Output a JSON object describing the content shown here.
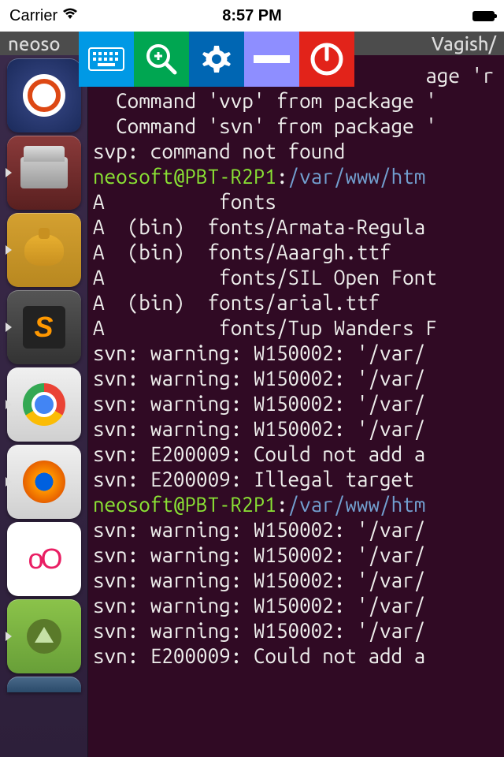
{
  "status_bar": {
    "carrier": "Carrier",
    "time": "8:57 PM"
  },
  "title_bar": {
    "left_text": "neoso",
    "right_text": "Vagish/"
  },
  "toolbar": {
    "keyboard_label": "keyboard",
    "zoom_label": "zoom",
    "settings_label": "settings",
    "minimize_label": "minimize",
    "power_label": "power"
  },
  "launcher_items": [
    "ubuntu-dash",
    "files",
    "genie-lamp",
    "sublime-text",
    "chrome",
    "firefox",
    "oo-app",
    "android-studio",
    "partial-app"
  ],
  "terminal": {
    "prompt_user": "neosoft@PBT-R2P1",
    "prompt_path": "/var/www/htm",
    "lines": [
      {
        "text": "                             age 'r"
      },
      {
        "text": "  Command 'vvp' from package '"
      },
      {
        "text": "  Command 'svn' from package '"
      },
      {
        "text": "svp: command not found"
      },
      {
        "prompt": true
      },
      {
        "text": "A          fonts"
      },
      {
        "text": "A  (bin)  fonts/Armata-Regula"
      },
      {
        "text": "A  (bin)  fonts/Aaargh.ttf"
      },
      {
        "text": "A          fonts/SIL Open Font"
      },
      {
        "text": "A  (bin)  fonts/arial.ttf"
      },
      {
        "text": "A          fonts/Tup Wanders F"
      },
      {
        "text": "svn: warning: W150002: '/var/"
      },
      {
        "text": "svn: warning: W150002: '/var/"
      },
      {
        "text": "svn: warning: W150002: '/var/"
      },
      {
        "text": "svn: warning: W150002: '/var/"
      },
      {
        "text": "svn: E200009: Could not add a"
      },
      {
        "text": "svn: E200009: Illegal target "
      },
      {
        "prompt": true
      },
      {
        "text": "svn: warning: W150002: '/var/"
      },
      {
        "text": "svn: warning: W150002: '/var/"
      },
      {
        "text": "svn: warning: W150002: '/var/"
      },
      {
        "text": "svn: warning: W150002: '/var/"
      },
      {
        "text": "svn: warning: W150002: '/var/"
      },
      {
        "text": "svn: E200009: Could not add a"
      }
    ]
  }
}
